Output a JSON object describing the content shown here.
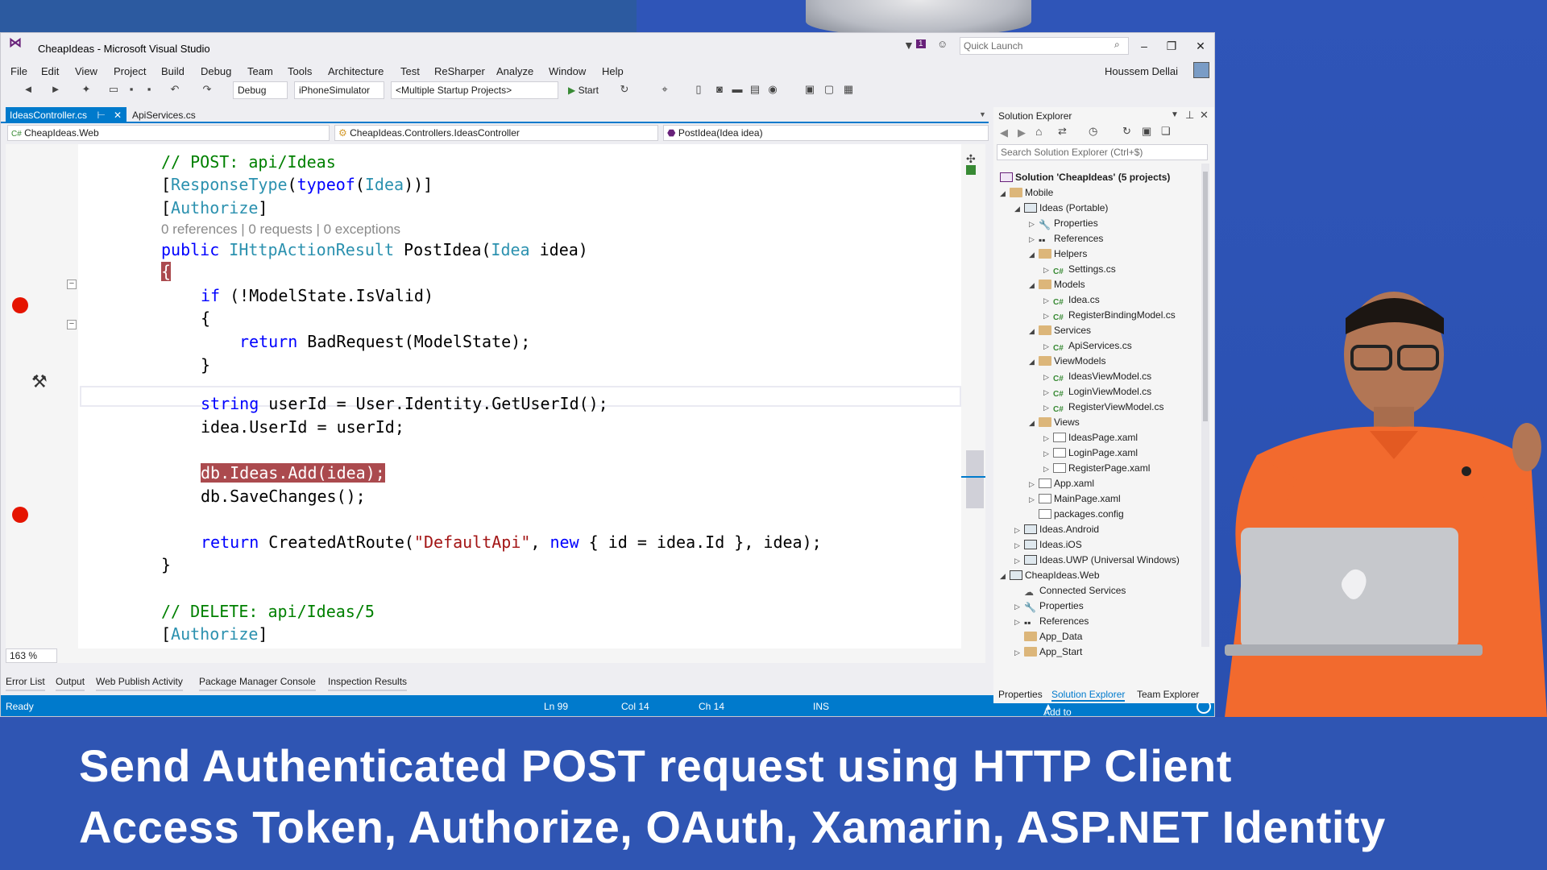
{
  "window": {
    "title": "CheapIdeas - Microsoft Visual Studio",
    "quick_launch_placeholder": "Quick Launch",
    "notification_count": "1"
  },
  "menu": [
    "File",
    "Edit",
    "View",
    "Project",
    "Build",
    "Debug",
    "Team",
    "Tools",
    "Architecture",
    "Test",
    "ReSharper",
    "Analyze",
    "Window",
    "Help"
  ],
  "user": "Houssem Dellai",
  "toolbar": {
    "configuration": "Debug",
    "platform": "iPhoneSimulator",
    "startup": "<Multiple Startup Projects>",
    "start": "Start"
  },
  "tabs": {
    "active": "IdeasController.cs",
    "other": "ApiServices.cs"
  },
  "navbar": {
    "project": "CheapIdeas.Web",
    "class": "CheapIdeas.Controllers.IdeasController",
    "member": "PostIdea(Idea idea)"
  },
  "code": {
    "l1": "// POST: api/Ideas",
    "l2a": "[",
    "l2b": "ResponseType",
    "l2c": "(",
    "l2d": "typeof",
    "l2e": "(",
    "l2f": "Idea",
    "l2g": "))]",
    "l3a": "[",
    "l3b": "Authorize",
    "l3c": "]",
    "lens": "0 references | 0 requests | 0 exceptions",
    "l4a": "public ",
    "l4b": "IHttpActionResult",
    "l4c": " PostIdea(",
    "l4d": "Idea",
    "l4e": " idea)",
    "l5": "{",
    "l6a": "if",
    "l6b": " (!ModelState.IsValid)",
    "l7": "{",
    "l8a": "return",
    "l8b": " BadRequest(ModelState);",
    "l9": "}",
    "l10a": "string",
    "l10b": " userId = User.Identity.GetUserId();",
    "l11": "idea.UserId = userId;",
    "l12": "db.Ideas.Add(idea);",
    "l13": "db.SaveChanges();",
    "l14a": "return",
    "l14b": " CreatedAtRoute(",
    "l14c": "\"DefaultApi\"",
    "l14d": ", ",
    "l14e": "new",
    "l14f": " { id = idea.Id }, idea);",
    "l15": "}",
    "l16": "// DELETE: api/Ideas/5",
    "l17a": "[",
    "l17b": "Authorize",
    "l17c": "]"
  },
  "zoom": "163 %",
  "bottom_tabs": [
    "Error List",
    "Output",
    "Web Publish Activity",
    "Package Manager Console",
    "Inspection Results"
  ],
  "status": {
    "ready": "Ready",
    "ln": "Ln 99",
    "col": "Col 14",
    "ch": "Ch 14",
    "ins": "INS",
    "source": "Add to Source Control"
  },
  "solution_explorer": {
    "title": "Solution Explorer",
    "search_placeholder": "Search Solution Explorer (Ctrl+$)",
    "items": [
      "Solution 'CheapIdeas' (5 projects)",
      "Mobile",
      "Ideas (Portable)",
      "Properties",
      "References",
      "Helpers",
      "Settings.cs",
      "Models",
      "Idea.cs",
      "RegisterBindingModel.cs",
      "Services",
      "ApiServices.cs",
      "ViewModels",
      "IdeasViewModel.cs",
      "LoginViewModel.cs",
      "RegisterViewModel.cs",
      "Views",
      "IdeasPage.xaml",
      "LoginPage.xaml",
      "RegisterPage.xaml",
      "App.xaml",
      "MainPage.xaml",
      "packages.config",
      "Ideas.Android",
      "Ideas.iOS",
      "Ideas.UWP (Universal Windows)",
      "CheapIdeas.Web",
      "Connected Services",
      "Properties",
      "References",
      "App_Data",
      "App_Start"
    ],
    "tabs": [
      "Properties",
      "Solution Explorer",
      "Team Explorer"
    ]
  },
  "caption": {
    "line1": "Send Authenticated POST request using HTTP Client",
    "line2": "Access Token, Authorize, OAuth, Xamarin, ASP.NET Identity"
  }
}
